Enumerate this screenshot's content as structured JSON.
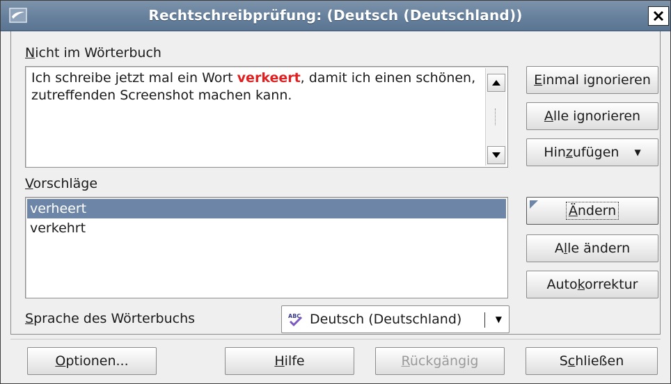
{
  "window": {
    "title": "Rechtschreibprüfung:  (Deutsch (Deutschland))"
  },
  "not_in_dictionary": {
    "label_first": "N",
    "label_rest": "icht im Wörterbuch",
    "text_before": "Ich schreibe jetzt mal ein Wort ",
    "misspelled_word": "verkeert",
    "text_after": ", damit ich einen schönen, zutreffenden Screenshot machen kann."
  },
  "suggestions": {
    "label_first": "V",
    "label_rest": "orschläge",
    "items": [
      {
        "label": "verheert",
        "selected": true
      },
      {
        "label": "verkehrt",
        "selected": false
      }
    ]
  },
  "dictionary_language": {
    "label_first": "S",
    "label_rest": "prache des Wörterbuchs",
    "value": "Deutsch (Deutschland)"
  },
  "side_buttons": {
    "ignore_once": {
      "ul": "E",
      "rest": "inmal ignorieren"
    },
    "ignore_all": {
      "ul": "A",
      "rest": "lle ignorieren"
    },
    "add": {
      "pre": "Hin",
      "ul": "z",
      "rest": "ufügen"
    },
    "change": {
      "ul": "Ä",
      "rest": "ndern"
    },
    "change_all": {
      "pre": "A",
      "ul": "l",
      "rest": "le ändern"
    },
    "autocorrect": {
      "pre": "Auto",
      "ul": "k",
      "rest": "orrektur"
    }
  },
  "footer_buttons": {
    "options": {
      "ul": "O",
      "rest": "ptionen..."
    },
    "help": {
      "ul": "H",
      "rest": "ilfe"
    },
    "undo": {
      "ul": "R",
      "rest": "ückgängig",
      "enabled": false
    },
    "close": {
      "pre": "S",
      "ul": "c",
      "rest": "hließen"
    }
  },
  "colors": {
    "titlebar": "#66809c",
    "selection": "#6d86a8",
    "error_text": "#e02020",
    "dialog_bg": "#efefef"
  }
}
